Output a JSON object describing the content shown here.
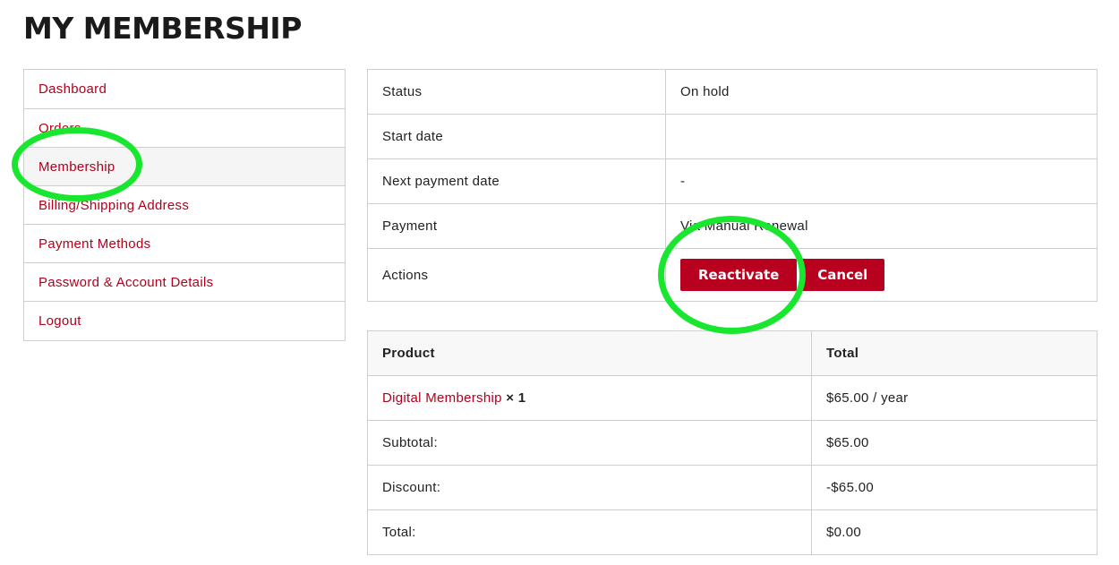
{
  "page": {
    "title": "MY MEMBERSHIP"
  },
  "nav": {
    "items": [
      {
        "label": "Dashboard"
      },
      {
        "label": "Orders"
      },
      {
        "label": "Membership",
        "active": true
      },
      {
        "label": "Billing/Shipping Address"
      },
      {
        "label": "Payment Methods"
      },
      {
        "label": "Password & Account Details"
      },
      {
        "label": "Logout"
      }
    ]
  },
  "membership": {
    "status_label": "Status",
    "status_value": "On hold",
    "start_label": "Start date",
    "start_value": "",
    "next_payment_label": "Next payment date",
    "next_payment_value": "-",
    "payment_label": "Payment",
    "payment_value": "Via Manual Renewal",
    "actions_label": "Actions",
    "reactivate_label": "Reactivate",
    "cancel_label": "Cancel"
  },
  "order": {
    "headers": {
      "product": "Product",
      "total": "Total"
    },
    "item": {
      "name": "Digital Membership",
      "qty": "× 1",
      "total": "$65.00 / year"
    },
    "rows": [
      {
        "label": "Subtotal:",
        "value": "$65.00"
      },
      {
        "label": "Discount:",
        "value": "-$65.00"
      },
      {
        "label": "Total:",
        "value": "$0.00"
      }
    ]
  },
  "colors": {
    "accent": "#b0001c",
    "button": "#b8001f",
    "annotation": "#19e62e"
  }
}
